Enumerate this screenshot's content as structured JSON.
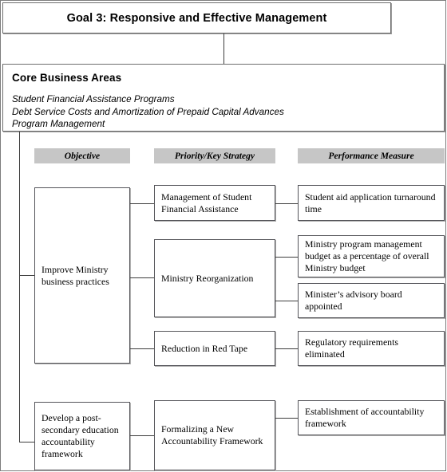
{
  "goal": {
    "title": "Goal 3: Responsive and Effective Management"
  },
  "core_business_areas": {
    "title": "Core Business Areas",
    "items": [
      "Student Financial Assistance Programs",
      "Debt Service Costs and Amortization of Prepaid Capital Advances",
      "Program Management"
    ]
  },
  "columns": {
    "objective": "Objective",
    "strategy": "Priority/Key Strategy",
    "measure": "Performance Measure"
  },
  "rows": {
    "objective_1": "Improve Ministry business practices",
    "objective_2": "Develop a post-secondary education accountability framework",
    "strategy_1": "Management of Student Financial Assistance",
    "strategy_2": "Ministry Reorganization",
    "strategy_3": "Reduction in Red Tape",
    "strategy_4": "Formalizing a New Accountability Framework",
    "measure_1": "Student aid application turnaround time",
    "measure_2": "Ministry program management budget as a percentage of overall Ministry budget",
    "measure_3": "Minister’s advisory board appointed",
    "measure_4": "Regulatory requirements eliminated",
    "measure_5": "Establishment of accountability framework"
  },
  "colors": {
    "header_fill": "#c6c6c6",
    "box_border": "#55555a",
    "connector": "#3d3d3d",
    "page_background": "#ffffff"
  }
}
